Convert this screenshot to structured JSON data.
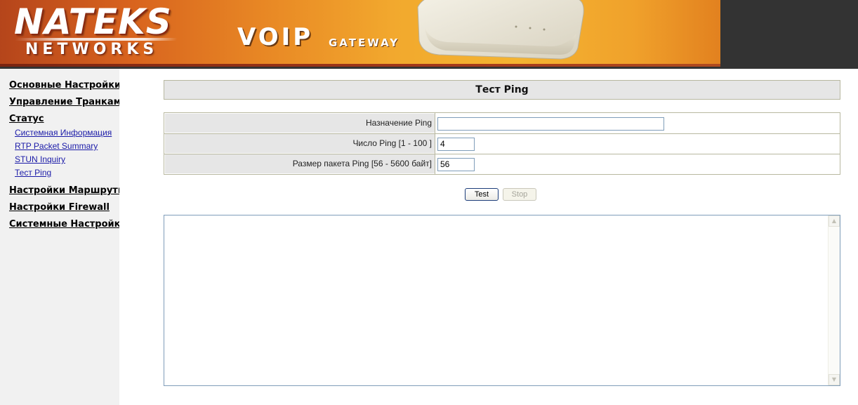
{
  "banner": {
    "brand_main": "NATEKS",
    "brand_sub": "NETWORKS",
    "product_main": "VOIP",
    "product_sub": "GATEWAY"
  },
  "sidebar": {
    "items": [
      {
        "label": "Основные Настройки"
      },
      {
        "label": "Управление Транками"
      },
      {
        "label": "Статус"
      },
      {
        "label": "Настройки Маршрутизации"
      },
      {
        "label": "Настройки Firewall"
      },
      {
        "label": "Системные Настройки"
      }
    ],
    "sub_items": [
      {
        "label": "Системная Информация"
      },
      {
        "label": "RTP Packet Summary"
      },
      {
        "label": "STUN Inquiry"
      },
      {
        "label": "Тест Ping"
      }
    ]
  },
  "main": {
    "title": "Тест Ping",
    "fields": [
      {
        "label": "Назначение Ping",
        "value": ""
      },
      {
        "label": "Число Ping [1 - 100 ]",
        "value": "4"
      },
      {
        "label": "Размер пакета Ping [56 - 5600 байт]",
        "value": "56"
      }
    ],
    "buttons": {
      "test": "Test",
      "stop": "Stop"
    },
    "output_text": ""
  },
  "colors": {
    "banner_dark": "#333333",
    "banner_orange": "#e98a25",
    "sidebar_bg": "#f1f1f1",
    "label_bg": "#e6e6e6",
    "link": "#1a1aa8",
    "border": "#b8b8a0"
  },
  "icons": {
    "scroll_up": "scroll-up-arrow-icon",
    "scroll_down": "scroll-down-arrow-icon"
  }
}
